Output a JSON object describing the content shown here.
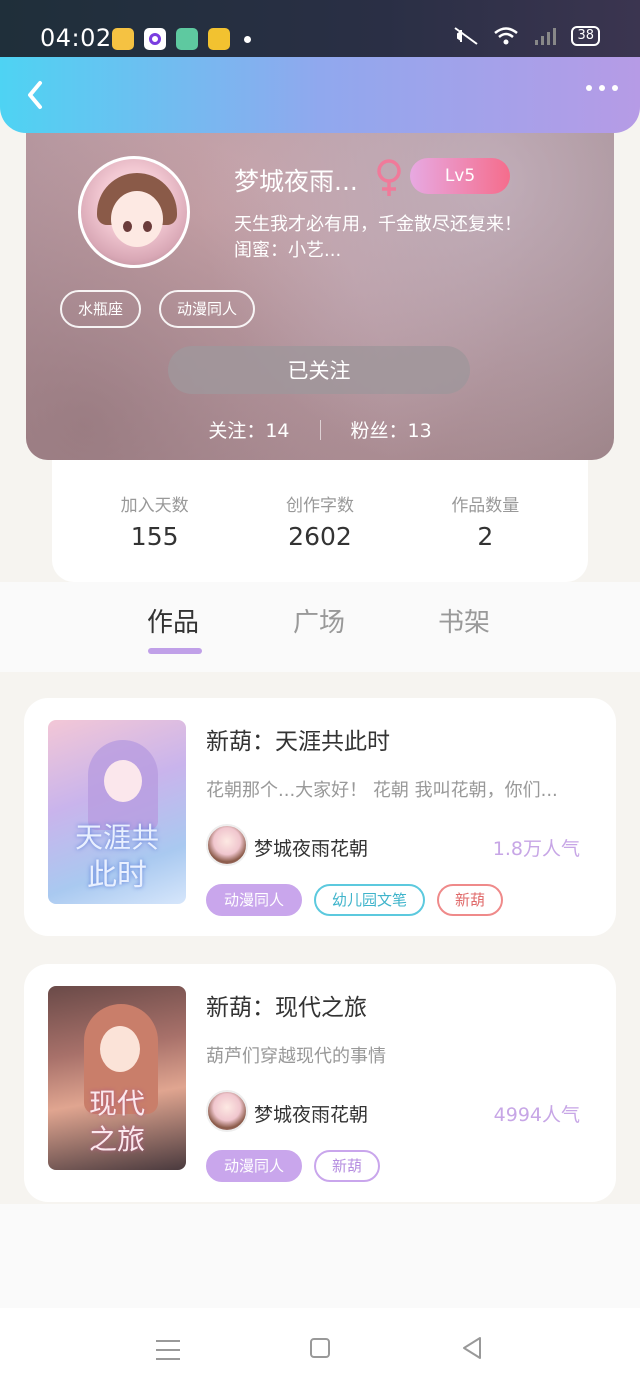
{
  "status_bar": {
    "time": "04:02",
    "battery": "38"
  },
  "header": {
    "back_icon": "chevron-left-icon",
    "more_icon": "more-dots-icon"
  },
  "profile": {
    "name": "梦城夜雨...",
    "gender_icon": "female-icon",
    "level": "Lv5",
    "bio": "天生我才必有用，千金散尽还复来！",
    "bff": "闺蜜：小艺...",
    "tags": [
      "水瓶座",
      "动漫同人"
    ],
    "follow_button": "已关注",
    "following": "关注：14",
    "followers": "粉丝：13"
  },
  "stats": [
    {
      "label": "加入天数",
      "value": "155"
    },
    {
      "label": "创作字数",
      "value": "2602"
    },
    {
      "label": "作品数量",
      "value": "2"
    }
  ],
  "tabs": [
    "作品",
    "广场",
    "书架"
  ],
  "works": [
    {
      "title": "新葫：天涯共此时",
      "desc": "花朝那个...大家好！ 花朝 我叫花朝，你们...",
      "author": "梦城夜雨花朝",
      "popularity": "1.8万人气",
      "tags": [
        "动漫同人",
        "幼儿园文笔",
        "新葫"
      ]
    },
    {
      "title": "新葫：现代之旅",
      "desc": "葫芦们穿越现代的事情",
      "author": "梦城夜雨花朝",
      "popularity": "4994人气",
      "tags": [
        "动漫同人",
        "新葫"
      ]
    }
  ],
  "colors": {
    "accent": "#c9a6ec",
    "header_start": "#4ed3f3",
    "header_end": "#b69be6"
  }
}
